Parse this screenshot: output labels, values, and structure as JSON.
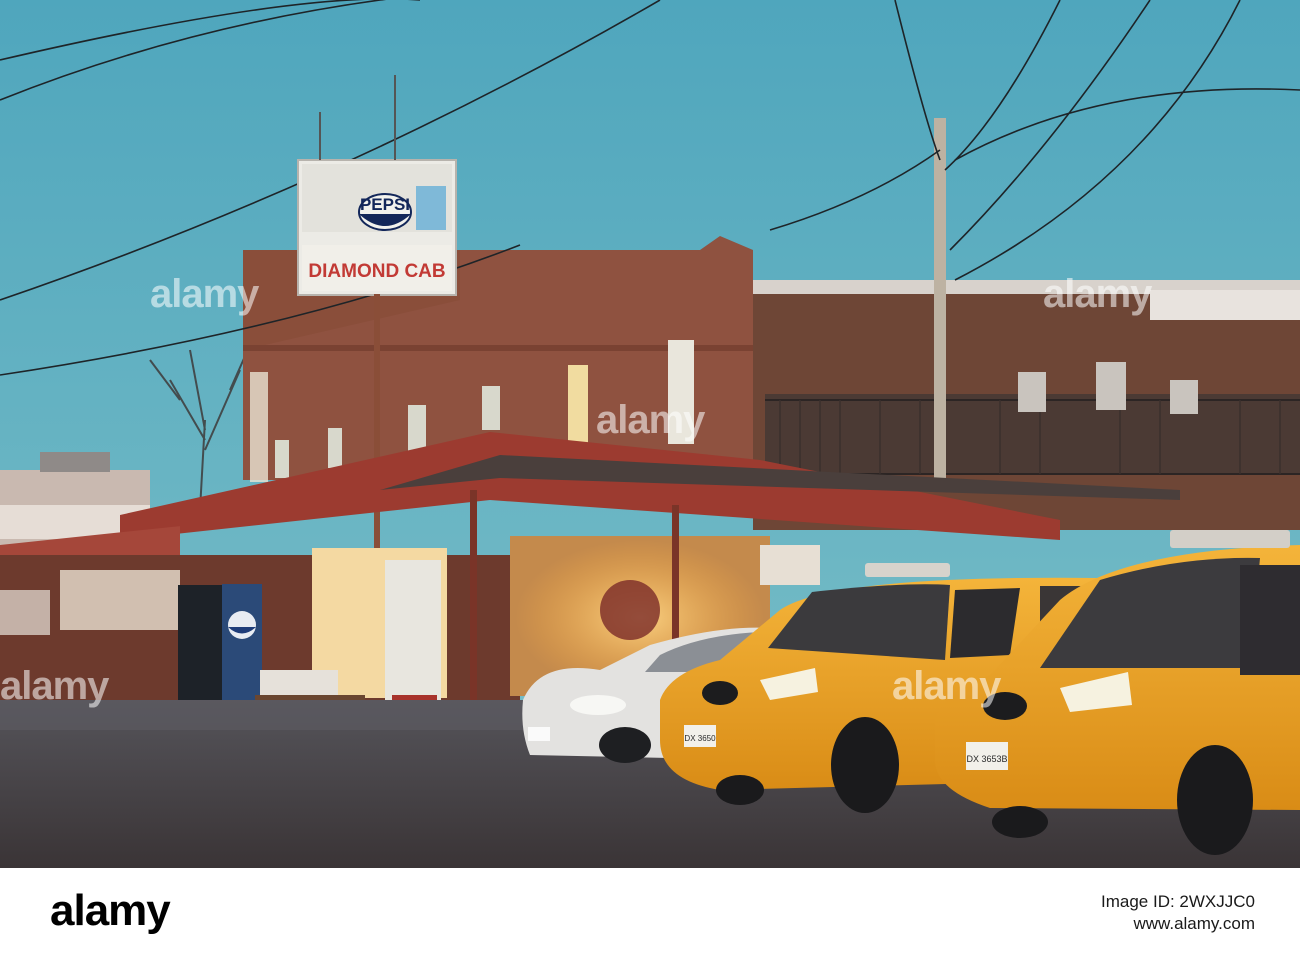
{
  "photo": {
    "sign_brand": "PEPSI",
    "sign_business": "DIAMOND CAB",
    "sky_color": "#5fb3c4",
    "taxi_color": "#f0a823",
    "plate_left": "DX 3650",
    "plate_right": "DX 3653B"
  },
  "watermarks": {
    "a": "alamy",
    "b": "alamy",
    "c": "alamy",
    "d": "alamy",
    "e": "alamy"
  },
  "footer": {
    "logo": "alamy",
    "image_id_line": "Image ID: 2WXJJC0",
    "site": "www.alamy.com"
  }
}
